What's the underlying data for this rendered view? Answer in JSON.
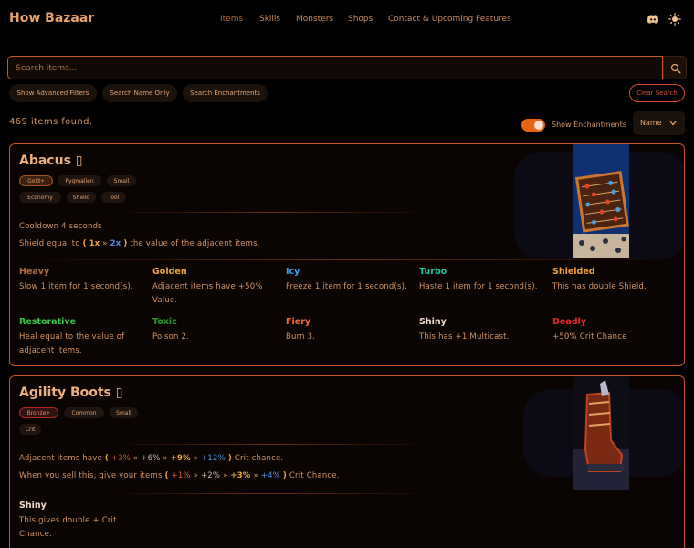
{
  "header": {
    "brand": "How Bazaar",
    "nav": [
      "Items",
      "Skills",
      "Monsters",
      "Shops",
      "Contact & Upcoming Features"
    ],
    "active_nav": "Items",
    "icons": [
      "discord-icon",
      "sun-icon"
    ]
  },
  "search": {
    "placeholder": "Search items...",
    "buttons": [
      "Show Advanced Filters",
      "Search Name Only",
      "Search Enchantments"
    ],
    "clear_label": "Clear Search"
  },
  "results": {
    "count_text": "469 items found.",
    "toggle_label": "Show Enchantments",
    "toggle_on": true,
    "sort_value": "Name"
  },
  "colors": {
    "accent": "#e86314",
    "border": "#c8561f",
    "gold": "#e9a53a",
    "blue": "#4f8fe3",
    "bronze": "#e0612c"
  },
  "items": [
    {
      "name": "Abacus",
      "name_glyph": "▯",
      "tags": [
        "Gold+",
        "Pygmalien",
        "Small",
        "Economy",
        "Shield",
        "Tool"
      ],
      "cooldown": "Cooldown 4 seconds",
      "effect": {
        "prefix": "Shield equal to",
        "open": "(",
        "v1": "1x",
        "sep": "»",
        "v2": "2x",
        "close": ")",
        "suffix": "the value of the adjacent items."
      },
      "enchantments": [
        {
          "name": "Heavy",
          "color": "#b06a3c",
          "desc": "Slow 1 item for 1 second(s)."
        },
        {
          "name": "Golden",
          "color": "#e9a53a",
          "desc": "Adjacent items have +50% Value."
        },
        {
          "name": "Icy",
          "color": "#3aa0e8",
          "desc": "Freeze 1 item for 1 second(s)."
        },
        {
          "name": "Turbo",
          "color": "#17c8a0",
          "desc": "Haste 1 item for 1 second(s)."
        },
        {
          "name": "Shielded",
          "color": "#f0a03a",
          "desc": "This has double Shield."
        },
        {
          "name": "Restorative",
          "color": "#3cc24a",
          "desc": "Heal equal to the value of adjacent items."
        },
        {
          "name": "Toxic",
          "color": "#2e9a2e",
          "desc": "Poison 2."
        },
        {
          "name": "Fiery",
          "color": "#ff6a2a",
          "desc": "Burn 3."
        },
        {
          "name": "Shiny",
          "color": "#f2dcd0",
          "desc": "This has +1 Multicast."
        },
        {
          "name": "Deadly",
          "color": "#e02a2a",
          "desc": "+50% Crit Chance"
        }
      ]
    },
    {
      "name": "Agility Boots",
      "name_glyph": "▯",
      "tags": [
        "Bronze+",
        "Common",
        "Small",
        "Crit"
      ],
      "effects": [
        {
          "prefix": "Adjacent items have",
          "open": "(",
          "values": [
            "+3%",
            "+6%",
            "+9%",
            "+12%"
          ],
          "sep": "»",
          "close": ")",
          "suffix": "Crit chance."
        },
        {
          "prefix": "When you sell this, give your items",
          "open": "(",
          "values": [
            "+1%",
            "+2%",
            "+3%",
            "+4%"
          ],
          "sep": "»",
          "close": ")",
          "suffix": "Crit Chance."
        }
      ],
      "enchantments": [
        {
          "name": "Shiny",
          "color": "#f2dcd0",
          "desc": "This gives double + Crit Chance."
        }
      ]
    }
  ]
}
